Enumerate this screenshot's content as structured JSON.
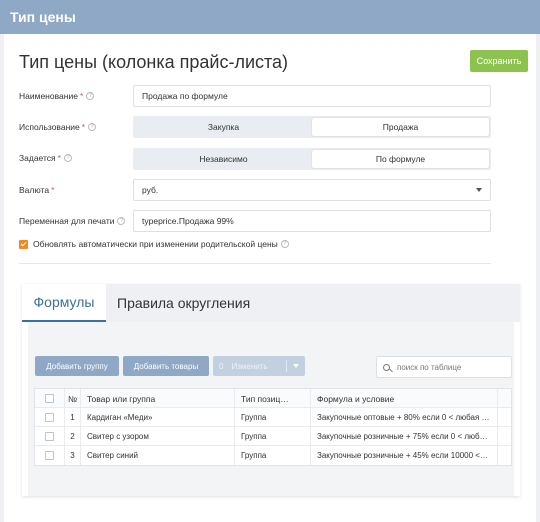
{
  "topbar": {
    "title": "Тип цены"
  },
  "page": {
    "title": "Тип цены (колонка прайс-листа)",
    "save_label": "Сохранить"
  },
  "form": {
    "name": {
      "label": "Наименование",
      "value": "Продажа по формуле"
    },
    "usage": {
      "label": "Использование",
      "options": [
        "Закупка",
        "Продажа"
      ],
      "selected": "Продажа"
    },
    "defined": {
      "label": "Задается",
      "options": [
        "Независимо",
        "По формуле"
      ],
      "selected": "По формуле"
    },
    "currency": {
      "label": "Валюта",
      "value": "руб."
    },
    "print_var": {
      "label": "Переменная для печати",
      "value": "typeprice.Продажа 99%"
    },
    "auto_update": {
      "label": "Обновлять автоматически при изменении родительской цены",
      "checked": true
    }
  },
  "tabs": [
    {
      "label": "Формулы",
      "active": true
    },
    {
      "label": "Правила округления",
      "active": false
    }
  ],
  "toolbar": {
    "add_group": "Добавить группу",
    "add_goods": "Добавить товары",
    "edit_count": "0",
    "edit_label": "Изменить"
  },
  "search": {
    "placeholder": "поиск по таблице"
  },
  "table": {
    "columns": [
      "№",
      "Товар или группа",
      "Тип позиц…",
      "Формула и условие"
    ],
    "rows": [
      {
        "num": "1",
        "name": "Кардиган «Меди»",
        "type": "Группа",
        "formula": "Закупочные оптовые + 80% если 0 < любая …"
      },
      {
        "num": "2",
        "name": "Свитер с узором",
        "type": "Группа",
        "formula": "Закупочные розничные + 75% если 0 < люб…"
      },
      {
        "num": "3",
        "name": "Свитер синий",
        "type": "Группа",
        "formula": "Закупочные розничные + 45% если 10000 <…"
      }
    ]
  },
  "colors": {
    "topbar": "#8fa8c6",
    "save": "#8dc24e",
    "accent": "#3d6f9e",
    "checkbox": "#f08a24",
    "required": "#e0524f"
  }
}
